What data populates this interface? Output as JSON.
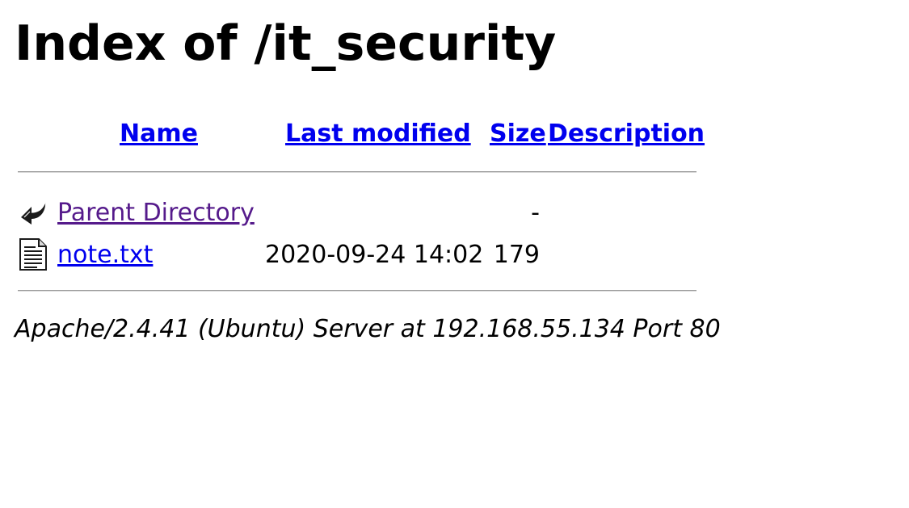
{
  "page": {
    "title": "Index of /it_security"
  },
  "table": {
    "headers": {
      "name": "Name",
      "last_modified": "Last modified",
      "size": "Size",
      "description": "Description"
    },
    "rows": [
      {
        "icon": "back-arrow-icon",
        "name": "Parent Directory",
        "last_modified": "",
        "size": "-",
        "description": ""
      },
      {
        "icon": "text-file-icon",
        "name": "note.txt",
        "last_modified": "2020-09-24 14:02",
        "size": "179",
        "description": ""
      }
    ]
  },
  "footer": {
    "address": "Apache/2.4.41 (Ubuntu) Server at 192.168.55.134 Port 80"
  },
  "colors": {
    "link": "#0000ee",
    "visited_link": "#551a8b",
    "text": "#000000",
    "background": "#ffffff"
  }
}
